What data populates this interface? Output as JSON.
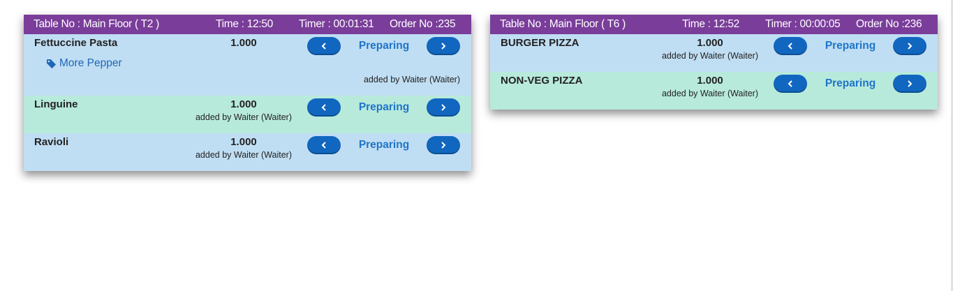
{
  "orders": [
    {
      "table": "Table No : Main Floor ( T2 )",
      "time": "Time : 12:50",
      "timer": "Timer : 00:01:31",
      "order_no": "Order No :235",
      "items": [
        {
          "name": "Fettuccine Pasta",
          "qty": "1.000",
          "modifier": "More Pepper",
          "added_by": "added by Waiter (Waiter)",
          "status": "Preparing",
          "row_color": "#c0def3"
        },
        {
          "name": "Linguine",
          "qty": "1.000",
          "added_by": "added by Waiter (Waiter)",
          "status": "Preparing",
          "row_color": "#b8eadc"
        },
        {
          "name": "Ravioli",
          "qty": "1.000",
          "added_by": "added by Waiter (Waiter)",
          "status": "Preparing",
          "row_color": "#c0def3"
        }
      ]
    },
    {
      "table": "Table No : Main Floor ( T6 )",
      "time": "Time : 12:52",
      "timer": "Timer : 00:00:05",
      "order_no": "Order No :236",
      "items": [
        {
          "name": "BURGER PIZZA",
          "qty": "1.000",
          "added_by": "added by Waiter (Waiter)",
          "status": "Preparing",
          "row_color": "#c0def3"
        },
        {
          "name": "NON-VEG PIZZA",
          "qty": "1.000",
          "added_by": "added by Waiter (Waiter)",
          "status": "Preparing",
          "row_color": "#b8eadc"
        }
      ]
    }
  ],
  "icons": {
    "prev": "chevron-left-icon",
    "next": "chevron-right-icon",
    "modifier": "tag-icon"
  },
  "colors": {
    "header": "#7a3d9a",
    "button": "#1167c0",
    "status": "#1f74c8"
  }
}
